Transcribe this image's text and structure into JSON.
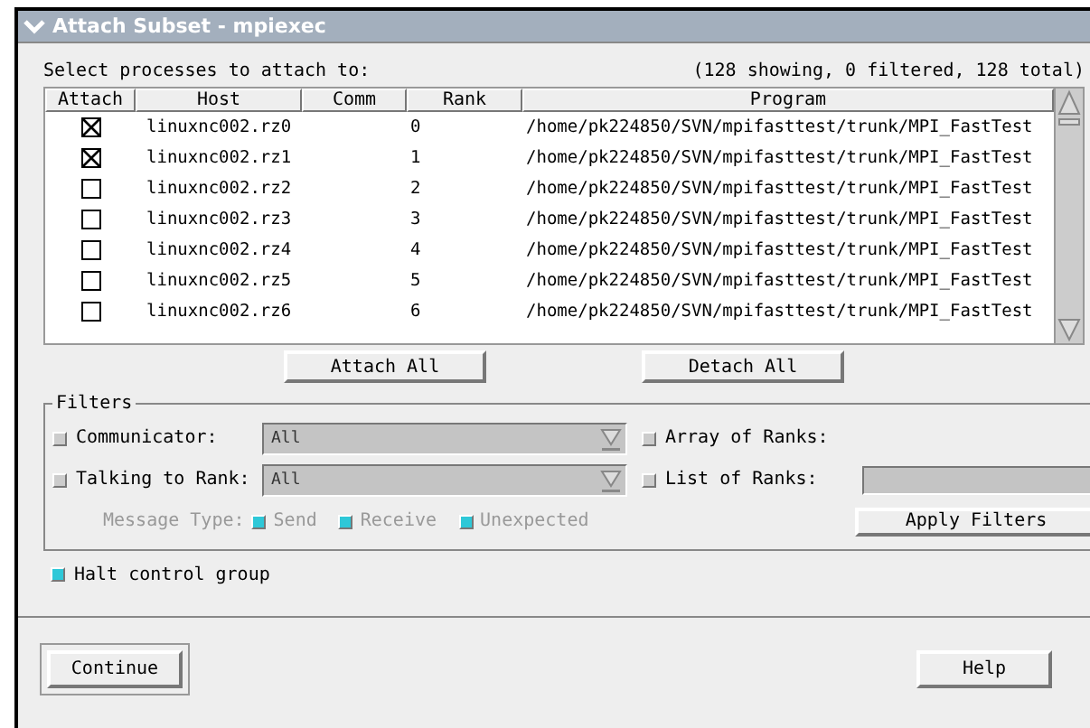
{
  "window": {
    "title": "Attach Subset - mpiexec"
  },
  "prompt": "Select processes to attach to:",
  "summary": "(128 showing, 0 filtered, 128 total)",
  "table": {
    "columns": [
      "Attach",
      "Host",
      "Comm",
      "Rank",
      "Program"
    ],
    "rows": [
      {
        "checked": true,
        "host": "linuxnc002.rz0",
        "comm": "",
        "rank": "0",
        "program": "/home/pk224850/SVN/mpifasttest/trunk/MPI_FastTest"
      },
      {
        "checked": true,
        "host": "linuxnc002.rz1",
        "comm": "",
        "rank": "1",
        "program": "/home/pk224850/SVN/mpifasttest/trunk/MPI_FastTest"
      },
      {
        "checked": false,
        "host": "linuxnc002.rz2",
        "comm": "",
        "rank": "2",
        "program": "/home/pk224850/SVN/mpifasttest/trunk/MPI_FastTest"
      },
      {
        "checked": false,
        "host": "linuxnc002.rz3",
        "comm": "",
        "rank": "3",
        "program": "/home/pk224850/SVN/mpifasttest/trunk/MPI_FastTest"
      },
      {
        "checked": false,
        "host": "linuxnc002.rz4",
        "comm": "",
        "rank": "4",
        "program": "/home/pk224850/SVN/mpifasttest/trunk/MPI_FastTest"
      },
      {
        "checked": false,
        "host": "linuxnc002.rz5",
        "comm": "",
        "rank": "5",
        "program": "/home/pk224850/SVN/mpifasttest/trunk/MPI_FastTest"
      },
      {
        "checked": false,
        "host": "linuxnc002.rz6",
        "comm": "",
        "rank": "6",
        "program": "/home/pk224850/SVN/mpifasttest/trunk/MPI_FastTest"
      }
    ]
  },
  "table_buttons": [
    "Attach All",
    "Detach All"
  ],
  "filters": {
    "title": "Filters",
    "communicator": {
      "label": "Communicator:",
      "checked": false,
      "value": "All"
    },
    "talking_to_rank": {
      "label": "Talking to Rank:",
      "checked": false,
      "value": "All"
    },
    "array_of_ranks": {
      "label": "Array of Ranks:",
      "checked": false
    },
    "list_of_ranks": {
      "label": "List of Ranks:",
      "checked": false
    },
    "message_type": {
      "label": "Message Type:",
      "disabled": true,
      "options": [
        {
          "label": "Send",
          "checked": true
        },
        {
          "label": "Receive",
          "checked": true
        },
        {
          "label": "Unexpected",
          "checked": true
        }
      ]
    },
    "apply_button": "Apply Filters"
  },
  "halt_control_group": {
    "label": "Halt control group",
    "checked": true
  },
  "buttons": [
    {
      "label": "Continue",
      "default": true
    },
    {
      "label": "Help",
      "default": false
    }
  ]
}
